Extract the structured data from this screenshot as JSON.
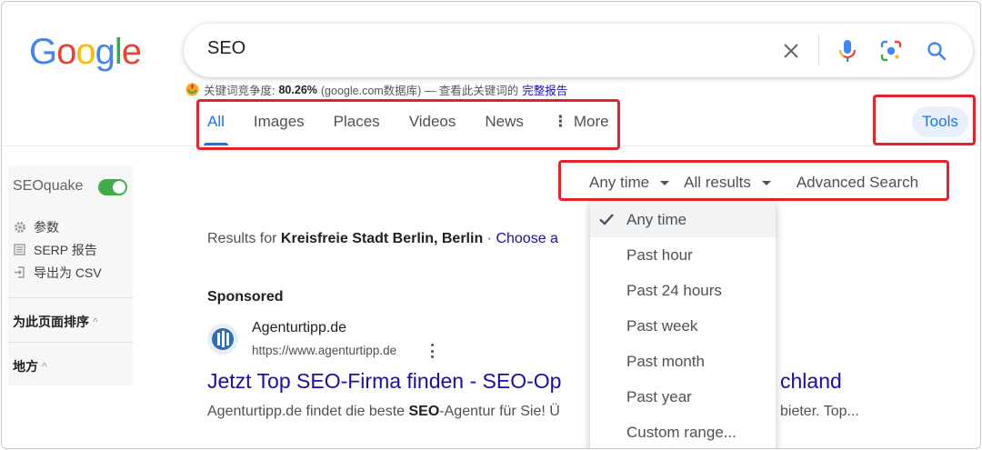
{
  "logo": {
    "letters": [
      "G",
      "o",
      "o",
      "g",
      "l",
      "e"
    ],
    "colors": [
      "#4285f4",
      "#ea4335",
      "#fbbc05",
      "#4285f4",
      "#34a853",
      "#ea4335"
    ]
  },
  "search": {
    "query": "SEO"
  },
  "icons": {
    "clear": "close-icon",
    "voice": "mic-icon",
    "lens": "lens-icon",
    "search": "search-icon"
  },
  "seoquake_bar": {
    "label": "关键词竞争度:",
    "value": "80.26%",
    "source": "(google.com数据库) — 查看此关键词的",
    "link": "完整报告"
  },
  "tabs": [
    {
      "label": "All",
      "active": true
    },
    {
      "label": "Images"
    },
    {
      "label": "Places"
    },
    {
      "label": "Videos"
    },
    {
      "label": "News"
    },
    {
      "label": "More"
    }
  ],
  "tools_label": "Tools",
  "filters": {
    "time": "Any time",
    "results": "All results",
    "advanced": "Advanced Search"
  },
  "time_dropdown": {
    "options": [
      "Any time",
      "Past hour",
      "Past 24 hours",
      "Past week",
      "Past month",
      "Past year",
      "Custom range..."
    ],
    "selected": "Any time"
  },
  "sidebar": {
    "title": "SEOquake",
    "toggle_on": true,
    "menu": [
      {
        "label": "参数",
        "icon": "gear-icon"
      },
      {
        "label": "SERP 报告",
        "icon": "report-icon"
      },
      {
        "label": "导出为 CSV",
        "icon": "export-icon"
      }
    ],
    "sections": [
      "为此页面排序",
      "地方"
    ]
  },
  "results": {
    "results_for_prefix": "Results for",
    "location": "Kreisfreie Stadt Berlin, Berlin",
    "separator": "·",
    "choose_link": "Choose a",
    "sponsored": "Sponsored",
    "ad": {
      "site": "Agenturtipp.de",
      "url": "https://www.agenturtipp.de",
      "title_start": "Jetzt Top SEO-Firma finden - SEO-Op",
      "title_end": "chland",
      "desc_start_a": "Agenturtipp.de findet die beste",
      "desc_bold": "SEO",
      "desc_start_b": "-Agentur für Sie! Ü",
      "desc_end": "bieter. Top..."
    }
  }
}
